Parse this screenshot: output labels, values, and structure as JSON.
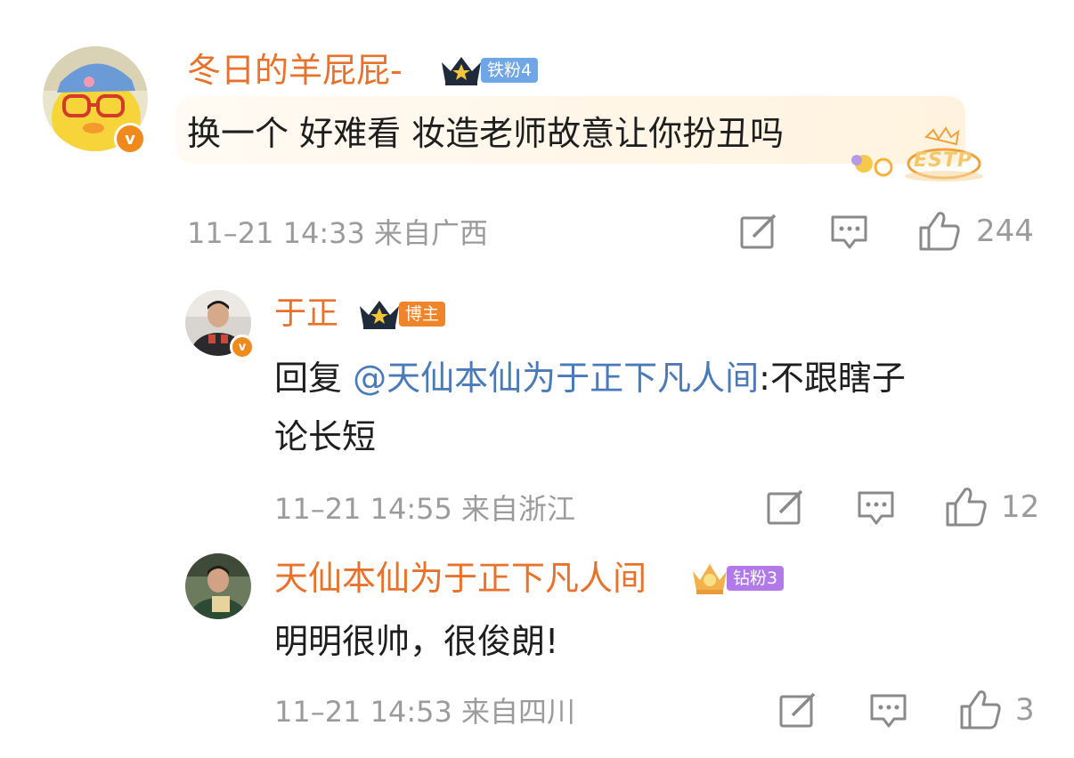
{
  "comments": [
    {
      "username": "冬日的羊屁屁-",
      "badge_label": "铁粉4",
      "content": "换一个 好难看 妆造老师故意让你扮丑吗",
      "card_tag": "ESTP",
      "meta": "11–21 14:33 来自广西",
      "likes": "244"
    },
    {
      "username": "于正",
      "badge_label": "博主",
      "reply_prefix": "回复 ",
      "mention": "@天仙本仙为于正下凡人间",
      "content_line1_rest": ":不跟瞎子",
      "content_line2": "论长短",
      "meta": "11–21 14:55 来自浙江",
      "likes": "12"
    },
    {
      "username": "天仙本仙为于正下凡人间",
      "badge_label": "钻粉3",
      "content": "明明很帅，很俊朗!",
      "meta": "11–21 14:53 来自四川",
      "likes": "3"
    }
  ],
  "colors": {
    "username": "#e8722a",
    "mention": "#4a7ab8",
    "meta": "#9b9b9b",
    "badge_iron": "#6fa6e6",
    "badge_blogger": "#f0842a",
    "badge_diamond": "#b17ae8"
  },
  "icons": {
    "repost": "share-edit-icon",
    "comment": "comment-bubble-icon",
    "like": "thumbs-up-icon",
    "verified": "verified-v-icon",
    "crown": "crown-icon"
  }
}
